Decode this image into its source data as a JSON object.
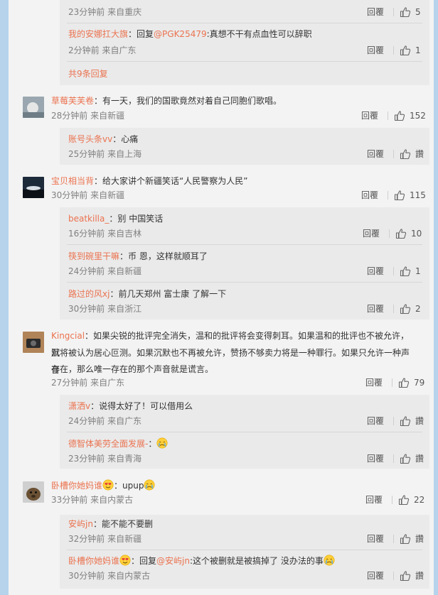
{
  "comments": [
    {
      "author": "草莓芙芙卷",
      "text": "有一天，我们的国歌竟然对着自己同胞们歌唱。",
      "time": "28分钟前",
      "source": "来自新疆",
      "reply_label": "回覆",
      "likes": "152",
      "replies": [
        {
          "author": "账号头条vv",
          "text": "心痛",
          "time": "25分钟前",
          "source": "来自上海",
          "reply_label": "回覆",
          "likes": "讚"
        }
      ]
    },
    {
      "author": "宝贝相当背",
      "text": "给大家讲个新疆笑话“人民警察为人民”",
      "time": "30分钟前",
      "source": "来自新疆",
      "reply_label": "回覆",
      "likes": "115",
      "replies": [
        {
          "author": "beatkilla_",
          "text": "别 中国笑话",
          "time": "16分钟前",
          "source": "来自吉林",
          "reply_label": "回覆",
          "likes": "10"
        },
        {
          "author": "筷到碗里干嘛",
          "text": "币 恩，这样就顺耳了",
          "time": "24分钟前",
          "source": "来自新疆",
          "reply_label": "回覆",
          "likes": "1"
        },
        {
          "author": "路过的风xj",
          "text": "前几天郑州 富士康 了解一下",
          "time": "30分钟前",
          "source": "来自浙江",
          "reply_label": "回覆",
          "likes": "2"
        }
      ]
    },
    {
      "author": "Kingcial",
      "text_lines": [
        "：如果尖锐的批评完全消失，温和的批评将会变得刺耳。如果温和的批评也不被允许，沉",
        "默将被认为居心叵测。如果沉默也不再被允许，赞扬不够卖力将是一种罪行。如果只允许一种声音",
        "存在，那么唯一存在的那个声音就是谎言。"
      ],
      "time": "27分钟前",
      "source": "来自广东",
      "reply_label": "回覆",
      "likes": "79",
      "replies": [
        {
          "author": "潇洒v",
          "text": "说得太好了！可以借用么",
          "time": "24分钟前",
          "source": "来自广东",
          "reply_label": "回覆",
          "likes": "讚"
        },
        {
          "author": "德智体美劳全面发展-",
          "text": "",
          "time": "23分钟前",
          "source": "来自青海",
          "reply_label": "回覆",
          "likes": "讚"
        }
      ]
    },
    {
      "author": "卧槽你她妈谁",
      "text": "：upup",
      "time": "33分钟前",
      "source": "来自内蒙古",
      "reply_label": "回覆",
      "likes": "22",
      "replies": [
        {
          "author": "安屿jn",
          "text": "能不能不要删",
          "time": "32分钟前",
          "source": "来自新疆",
          "reply_label": "回覆",
          "likes": "讚"
        },
        {
          "author": "卧槽你她妈谁",
          "reply_prefix": "：回复",
          "mention": "@安屿jn",
          "text": ":这个被删就是被搞掉了 没办法的事",
          "time": "30分钟前",
          "source": "来自内蒙古",
          "reply_label": "回覆",
          "likes": "讚"
        }
      ]
    }
  ],
  "top_thread": {
    "cut_time": "23分钟前",
    "cut_source": "来自重庆",
    "cut_reply_label": "回覆",
    "cut_likes": "5",
    "reply_author": "我的安娜扛大旗",
    "reply_prefix": "：回复",
    "reply_mention": "@PGK25479",
    "reply_text": ":真想不干有点血性可以辞职",
    "reply_time": "2分钟前",
    "reply_source": "来自广东",
    "reply_label": "回覆",
    "reply_likes": "1",
    "more_replies": "共9条回复"
  },
  "colors": {
    "name": "#eb7350",
    "meta": "#808080",
    "panel": "#f3f3f3",
    "reply_bg": "#eaeaea"
  }
}
